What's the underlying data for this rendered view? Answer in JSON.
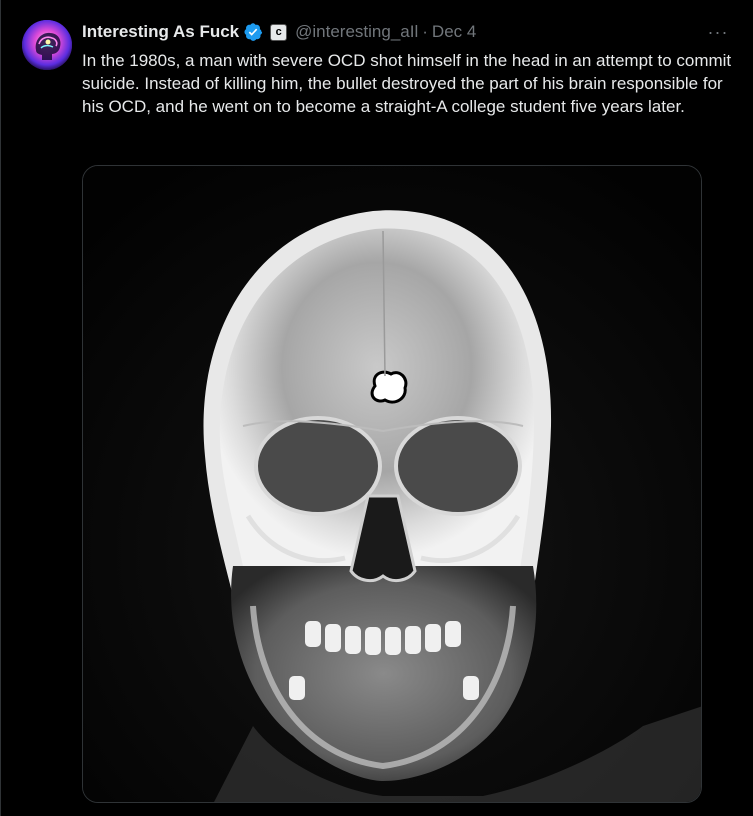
{
  "author": {
    "display_name": "Interesting As Fuck",
    "handle": "@interesting_aIl",
    "separator": "·",
    "date": "Dec 4",
    "verified_icon": "verified-badge-icon",
    "affiliate_badge": "c"
  },
  "tweet": {
    "text": "In the 1980s, a man with severe OCD shot himself in the head in an attempt to commit suicide. Instead of killing him, the bullet destroyed the part of his brain responsible for his OCD, and he went on to become a straight-A college student five years later."
  },
  "actions": {
    "more_label": "···"
  },
  "media": {
    "type": "skull-xray-image"
  },
  "colors": {
    "background": "#000000",
    "text_primary": "#e7e9ea",
    "text_secondary": "#71767b",
    "verified_blue": "#1d9bf0"
  }
}
